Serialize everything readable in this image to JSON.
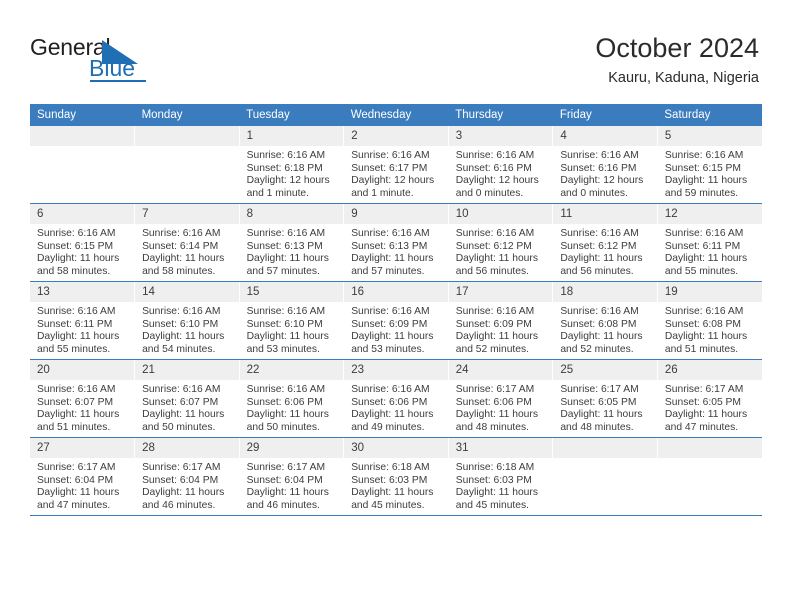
{
  "brand": {
    "name_top": "General",
    "name_bottom": "Blue",
    "accent_color": "#1f6fb5"
  },
  "header": {
    "title": "October 2024",
    "subtitle": "Kauru, Kaduna, Nigeria"
  },
  "theme": {
    "header_row_bg": "#3a7cbe",
    "daynum_bg": "#efefef",
    "row_border": "#3a7cbe"
  },
  "weekday_headers": [
    "Sunday",
    "Monday",
    "Tuesday",
    "Wednesday",
    "Thursday",
    "Friday",
    "Saturday"
  ],
  "weeks": [
    [
      {
        "day": "",
        "sunrise": "",
        "sunset": "",
        "daylight_line1": "",
        "daylight_line2": ""
      },
      {
        "day": "",
        "sunrise": "",
        "sunset": "",
        "daylight_line1": "",
        "daylight_line2": ""
      },
      {
        "day": "1",
        "sunrise": "Sunrise: 6:16 AM",
        "sunset": "Sunset: 6:18 PM",
        "daylight_line1": "Daylight: 12 hours",
        "daylight_line2": "and 1 minute."
      },
      {
        "day": "2",
        "sunrise": "Sunrise: 6:16 AM",
        "sunset": "Sunset: 6:17 PM",
        "daylight_line1": "Daylight: 12 hours",
        "daylight_line2": "and 1 minute."
      },
      {
        "day": "3",
        "sunrise": "Sunrise: 6:16 AM",
        "sunset": "Sunset: 6:16 PM",
        "daylight_line1": "Daylight: 12 hours",
        "daylight_line2": "and 0 minutes."
      },
      {
        "day": "4",
        "sunrise": "Sunrise: 6:16 AM",
        "sunset": "Sunset: 6:16 PM",
        "daylight_line1": "Daylight: 12 hours",
        "daylight_line2": "and 0 minutes."
      },
      {
        "day": "5",
        "sunrise": "Sunrise: 6:16 AM",
        "sunset": "Sunset: 6:15 PM",
        "daylight_line1": "Daylight: 11 hours",
        "daylight_line2": "and 59 minutes."
      }
    ],
    [
      {
        "day": "6",
        "sunrise": "Sunrise: 6:16 AM",
        "sunset": "Sunset: 6:15 PM",
        "daylight_line1": "Daylight: 11 hours",
        "daylight_line2": "and 58 minutes."
      },
      {
        "day": "7",
        "sunrise": "Sunrise: 6:16 AM",
        "sunset": "Sunset: 6:14 PM",
        "daylight_line1": "Daylight: 11 hours",
        "daylight_line2": "and 58 minutes."
      },
      {
        "day": "8",
        "sunrise": "Sunrise: 6:16 AM",
        "sunset": "Sunset: 6:13 PM",
        "daylight_line1": "Daylight: 11 hours",
        "daylight_line2": "and 57 minutes."
      },
      {
        "day": "9",
        "sunrise": "Sunrise: 6:16 AM",
        "sunset": "Sunset: 6:13 PM",
        "daylight_line1": "Daylight: 11 hours",
        "daylight_line2": "and 57 minutes."
      },
      {
        "day": "10",
        "sunrise": "Sunrise: 6:16 AM",
        "sunset": "Sunset: 6:12 PM",
        "daylight_line1": "Daylight: 11 hours",
        "daylight_line2": "and 56 minutes."
      },
      {
        "day": "11",
        "sunrise": "Sunrise: 6:16 AM",
        "sunset": "Sunset: 6:12 PM",
        "daylight_line1": "Daylight: 11 hours",
        "daylight_line2": "and 56 minutes."
      },
      {
        "day": "12",
        "sunrise": "Sunrise: 6:16 AM",
        "sunset": "Sunset: 6:11 PM",
        "daylight_line1": "Daylight: 11 hours",
        "daylight_line2": "and 55 minutes."
      }
    ],
    [
      {
        "day": "13",
        "sunrise": "Sunrise: 6:16 AM",
        "sunset": "Sunset: 6:11 PM",
        "daylight_line1": "Daylight: 11 hours",
        "daylight_line2": "and 55 minutes."
      },
      {
        "day": "14",
        "sunrise": "Sunrise: 6:16 AM",
        "sunset": "Sunset: 6:10 PM",
        "daylight_line1": "Daylight: 11 hours",
        "daylight_line2": "and 54 minutes."
      },
      {
        "day": "15",
        "sunrise": "Sunrise: 6:16 AM",
        "sunset": "Sunset: 6:10 PM",
        "daylight_line1": "Daylight: 11 hours",
        "daylight_line2": "and 53 minutes."
      },
      {
        "day": "16",
        "sunrise": "Sunrise: 6:16 AM",
        "sunset": "Sunset: 6:09 PM",
        "daylight_line1": "Daylight: 11 hours",
        "daylight_line2": "and 53 minutes."
      },
      {
        "day": "17",
        "sunrise": "Sunrise: 6:16 AM",
        "sunset": "Sunset: 6:09 PM",
        "daylight_line1": "Daylight: 11 hours",
        "daylight_line2": "and 52 minutes."
      },
      {
        "day": "18",
        "sunrise": "Sunrise: 6:16 AM",
        "sunset": "Sunset: 6:08 PM",
        "daylight_line1": "Daylight: 11 hours",
        "daylight_line2": "and 52 minutes."
      },
      {
        "day": "19",
        "sunrise": "Sunrise: 6:16 AM",
        "sunset": "Sunset: 6:08 PM",
        "daylight_line1": "Daylight: 11 hours",
        "daylight_line2": "and 51 minutes."
      }
    ],
    [
      {
        "day": "20",
        "sunrise": "Sunrise: 6:16 AM",
        "sunset": "Sunset: 6:07 PM",
        "daylight_line1": "Daylight: 11 hours",
        "daylight_line2": "and 51 minutes."
      },
      {
        "day": "21",
        "sunrise": "Sunrise: 6:16 AM",
        "sunset": "Sunset: 6:07 PM",
        "daylight_line1": "Daylight: 11 hours",
        "daylight_line2": "and 50 minutes."
      },
      {
        "day": "22",
        "sunrise": "Sunrise: 6:16 AM",
        "sunset": "Sunset: 6:06 PM",
        "daylight_line1": "Daylight: 11 hours",
        "daylight_line2": "and 50 minutes."
      },
      {
        "day": "23",
        "sunrise": "Sunrise: 6:16 AM",
        "sunset": "Sunset: 6:06 PM",
        "daylight_line1": "Daylight: 11 hours",
        "daylight_line2": "and 49 minutes."
      },
      {
        "day": "24",
        "sunrise": "Sunrise: 6:17 AM",
        "sunset": "Sunset: 6:06 PM",
        "daylight_line1": "Daylight: 11 hours",
        "daylight_line2": "and 48 minutes."
      },
      {
        "day": "25",
        "sunrise": "Sunrise: 6:17 AM",
        "sunset": "Sunset: 6:05 PM",
        "daylight_line1": "Daylight: 11 hours",
        "daylight_line2": "and 48 minutes."
      },
      {
        "day": "26",
        "sunrise": "Sunrise: 6:17 AM",
        "sunset": "Sunset: 6:05 PM",
        "daylight_line1": "Daylight: 11 hours",
        "daylight_line2": "and 47 minutes."
      }
    ],
    [
      {
        "day": "27",
        "sunrise": "Sunrise: 6:17 AM",
        "sunset": "Sunset: 6:04 PM",
        "daylight_line1": "Daylight: 11 hours",
        "daylight_line2": "and 47 minutes."
      },
      {
        "day": "28",
        "sunrise": "Sunrise: 6:17 AM",
        "sunset": "Sunset: 6:04 PM",
        "daylight_line1": "Daylight: 11 hours",
        "daylight_line2": "and 46 minutes."
      },
      {
        "day": "29",
        "sunrise": "Sunrise: 6:17 AM",
        "sunset": "Sunset: 6:04 PM",
        "daylight_line1": "Daylight: 11 hours",
        "daylight_line2": "and 46 minutes."
      },
      {
        "day": "30",
        "sunrise": "Sunrise: 6:18 AM",
        "sunset": "Sunset: 6:03 PM",
        "daylight_line1": "Daylight: 11 hours",
        "daylight_line2": "and 45 minutes."
      },
      {
        "day": "31",
        "sunrise": "Sunrise: 6:18 AM",
        "sunset": "Sunset: 6:03 PM",
        "daylight_line1": "Daylight: 11 hours",
        "daylight_line2": "and 45 minutes."
      },
      {
        "day": "",
        "sunrise": "",
        "sunset": "",
        "daylight_line1": "",
        "daylight_line2": ""
      },
      {
        "day": "",
        "sunrise": "",
        "sunset": "",
        "daylight_line1": "",
        "daylight_line2": ""
      }
    ]
  ]
}
